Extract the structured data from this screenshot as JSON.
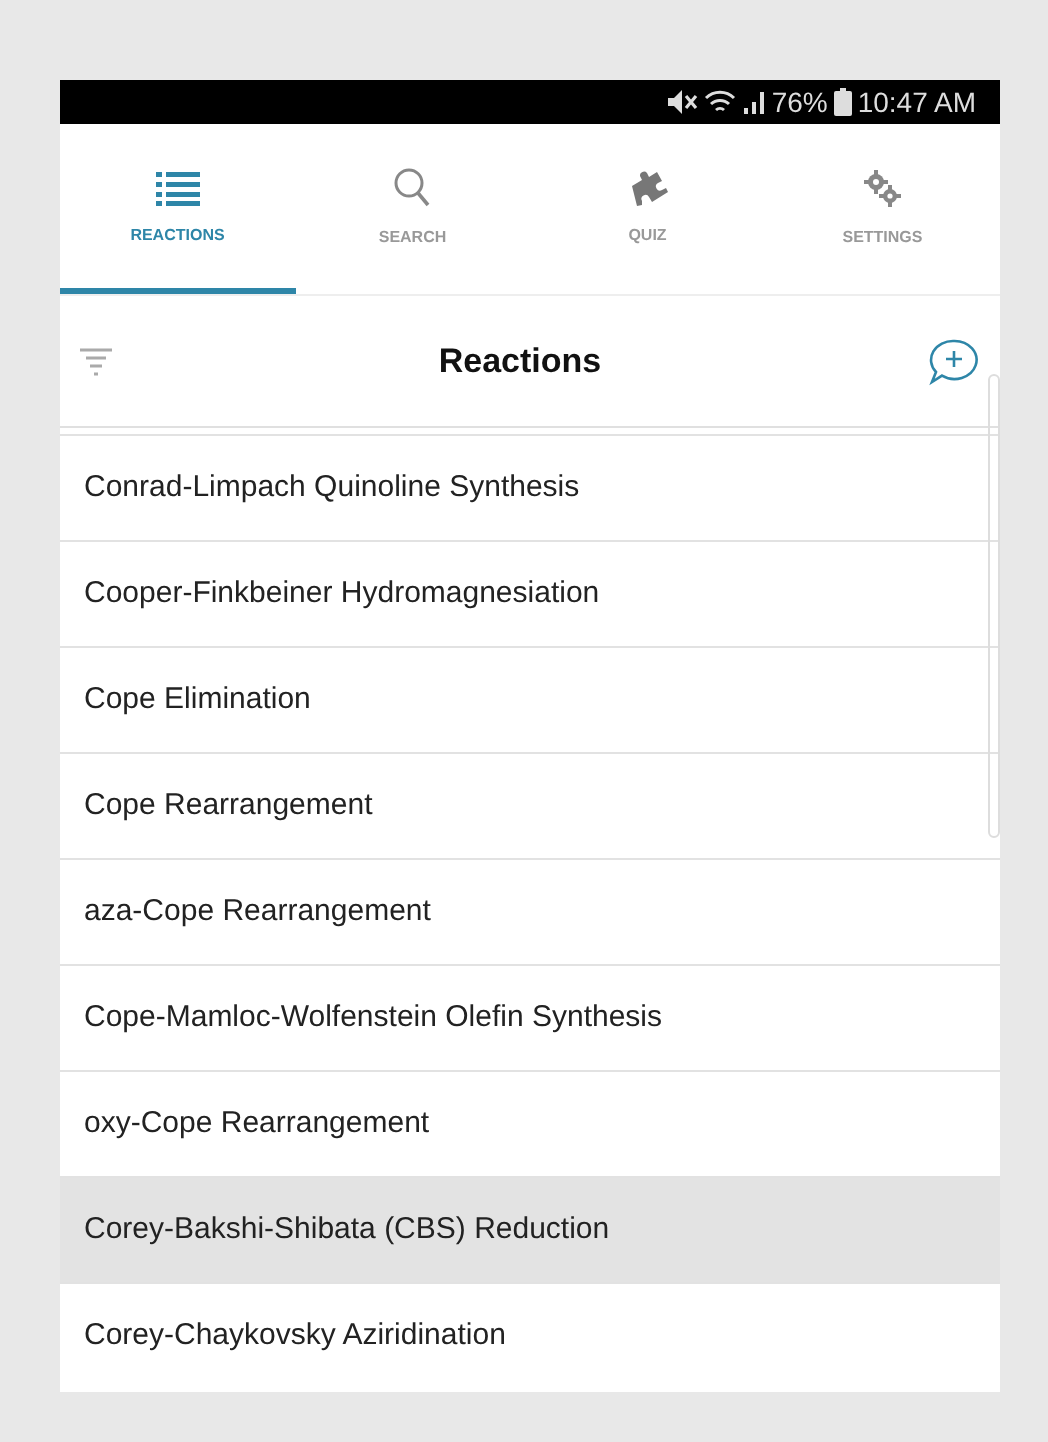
{
  "status_bar": {
    "battery": "76%",
    "time": "10:47 AM"
  },
  "tabs": [
    {
      "label": "REACTIONS",
      "kind": "list",
      "selected": true
    },
    {
      "label": "SEARCH",
      "kind": "search",
      "selected": false
    },
    {
      "label": "QUIZ",
      "kind": "puzzle",
      "selected": false
    },
    {
      "label": "SETTINGS",
      "kind": "gears",
      "selected": false
    }
  ],
  "header": {
    "title": "Reactions"
  },
  "reactions": [
    {
      "name": "Conrad-Limpach Quinoline Synthesis",
      "selected": false
    },
    {
      "name": "Cooper-Finkbeiner Hydromagnesiation",
      "selected": false
    },
    {
      "name": "Cope Elimination",
      "selected": false
    },
    {
      "name": "Cope Rearrangement",
      "selected": false
    },
    {
      "name": "aza-Cope Rearrangement",
      "selected": false
    },
    {
      "name": "Cope-Mamloc-Wolfenstein Olefin Synthesis",
      "selected": false
    },
    {
      "name": "oxy-Cope Rearrangement",
      "selected": false
    },
    {
      "name": "Corey-Bakshi-Shibata (CBS) Reduction",
      "selected": true
    },
    {
      "name": "Corey-Chaykovsky Aziridination",
      "selected": false
    }
  ]
}
